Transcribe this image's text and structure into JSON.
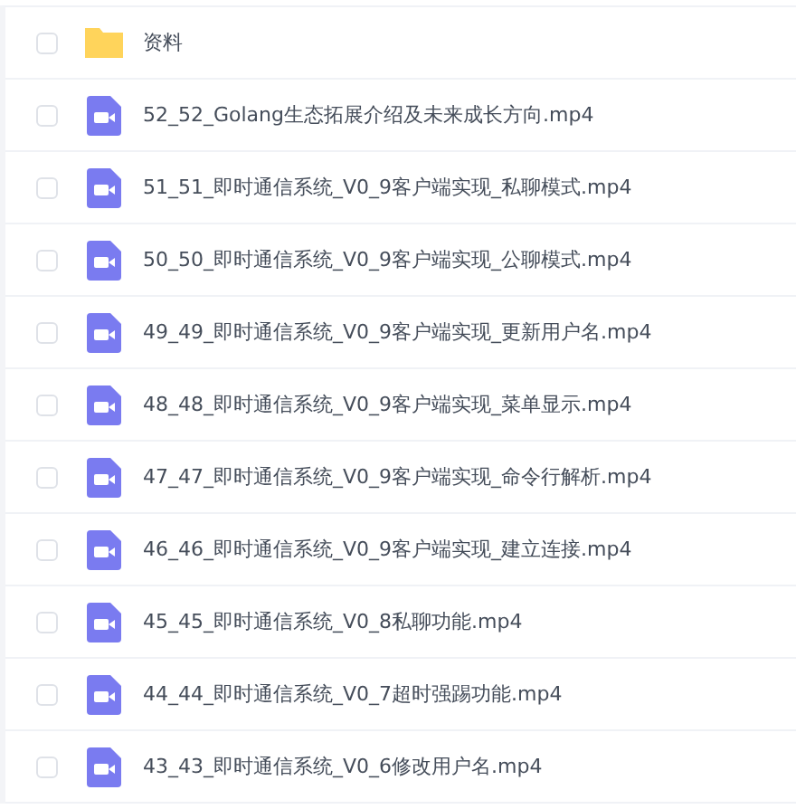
{
  "files": [
    {
      "kind": "folder",
      "name": "资料",
      "checked": false
    },
    {
      "kind": "video",
      "name": "52_52_Golang生态拓展介绍及未来成长方向.mp4",
      "checked": false
    },
    {
      "kind": "video",
      "name": "51_51_即时通信系统_V0_9客户端实现_私聊模式.mp4",
      "checked": false
    },
    {
      "kind": "video",
      "name": "50_50_即时通信系统_V0_9客户端实现_公聊模式.mp4",
      "checked": false
    },
    {
      "kind": "video",
      "name": "49_49_即时通信系统_V0_9客户端实现_更新用户名.mp4",
      "checked": false
    },
    {
      "kind": "video",
      "name": "48_48_即时通信系统_V0_9客户端实现_菜单显示.mp4",
      "checked": false
    },
    {
      "kind": "video",
      "name": "47_47_即时通信系统_V0_9客户端实现_命令行解析.mp4",
      "checked": false
    },
    {
      "kind": "video",
      "name": "46_46_即时通信系统_V0_9客户端实现_建立连接.mp4",
      "checked": false
    },
    {
      "kind": "video",
      "name": "45_45_即时通信系统_V0_8私聊功能.mp4",
      "checked": false
    },
    {
      "kind": "video",
      "name": "44_44_即时通信系统_V0_7超时强踢功能.mp4",
      "checked": false
    },
    {
      "kind": "video",
      "name": "43_43_即时通信系统_V0_6修改用户名.mp4",
      "checked": false
    }
  ]
}
